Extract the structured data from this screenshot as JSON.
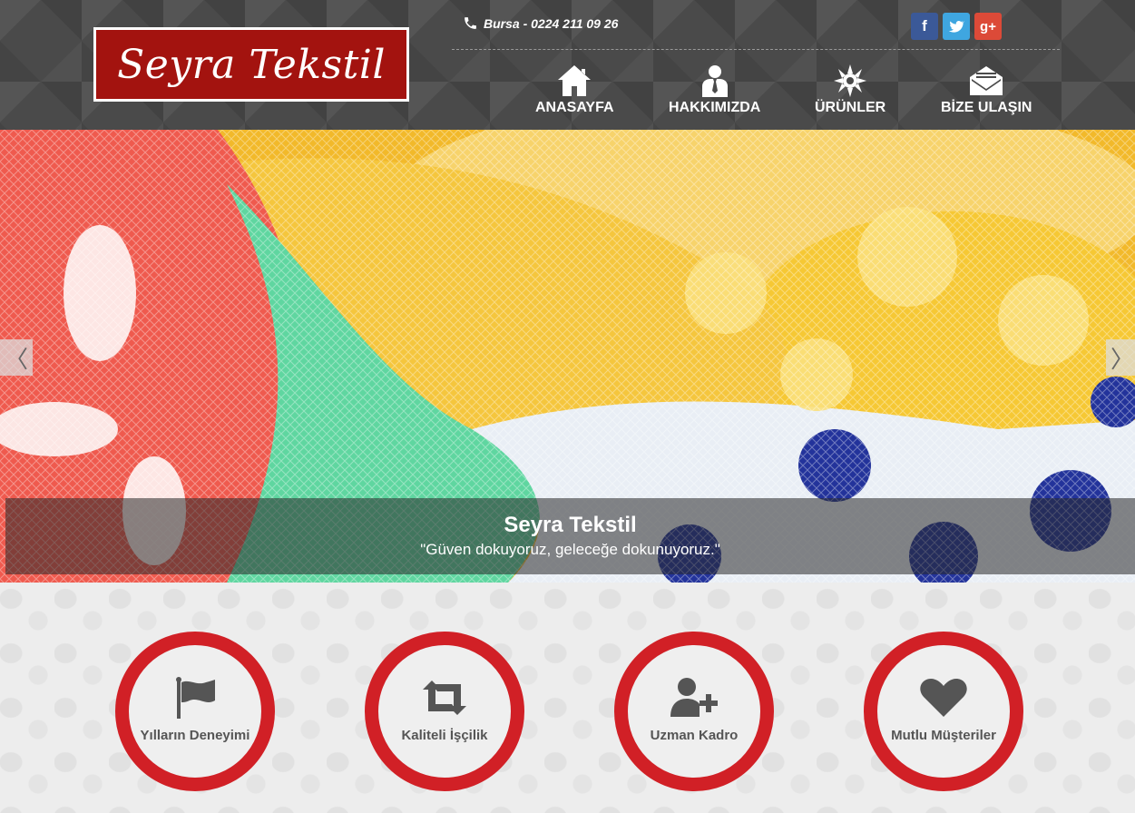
{
  "brand": {
    "name": "Seyra Tekstil",
    "logo_bg": "#a3130f"
  },
  "contact": {
    "phone_text": "Bursa - 0224 211 09 26",
    "icon": "phone-icon"
  },
  "social": [
    {
      "label": "f",
      "icon": "facebook-icon",
      "color": "#3b5998"
    },
    {
      "label": "t",
      "icon": "twitter-icon",
      "color": "#3fa6e0"
    },
    {
      "label": "g+",
      "icon": "google-plus-icon",
      "color": "#dc4a38"
    }
  ],
  "nav": [
    {
      "label": "ANASAYFA",
      "icon": "home-icon"
    },
    {
      "label": "HAKKIMIZDA",
      "icon": "person-icon"
    },
    {
      "label": "ÜRÜNLER",
      "icon": "gear-icon"
    },
    {
      "label": "BİZE ULAŞIN",
      "icon": "mail-icon"
    }
  ],
  "slider": {
    "prev_label": "〈",
    "next_label": "〉",
    "caption_title": "Seyra Tekstil",
    "caption_text": "\"Güven dokuyoruz, geleceğe dokunuyoruz.\""
  },
  "features": [
    {
      "label": "Yılların Deneyimi",
      "icon": "flag-icon"
    },
    {
      "label": "Kaliteli İşçilik",
      "icon": "retweet-icon"
    },
    {
      "label": "Uzman Kadro",
      "icon": "add-user-icon"
    },
    {
      "label": "Mutlu Müşteriler",
      "icon": "heart-icon"
    }
  ],
  "colors": {
    "accent": "#d12026",
    "header_bg": "#4a4a4a"
  }
}
